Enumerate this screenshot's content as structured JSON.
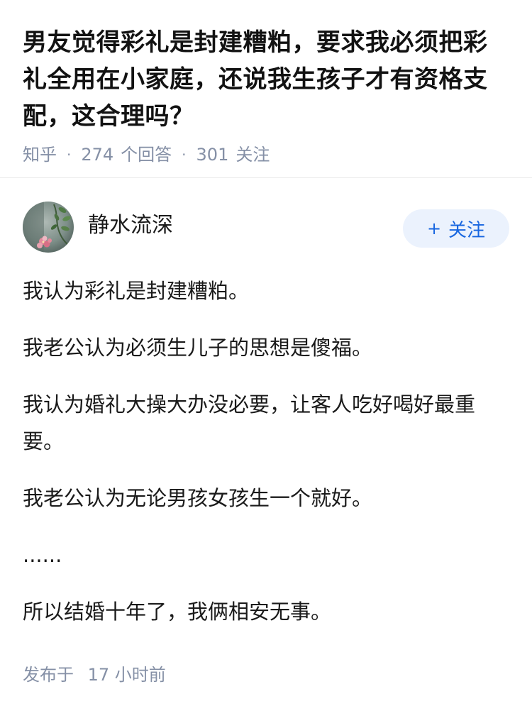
{
  "question": {
    "title": "男友觉得彩礼是封建糟粕，要求我必须把彩礼全用在小家庭，还说我生孩子才有资格支配，这合理吗？",
    "source": "知乎",
    "answer_count": "274",
    "answer_label": "个回答",
    "follower_count": "301",
    "follower_label": "关注",
    "separator": "·"
  },
  "author": {
    "name": "静水流深",
    "avatar_icon": "avatar-photo",
    "follow_label": "关注",
    "follow_icon": "plus-icon",
    "follow_color": "#1766e0",
    "follow_bg": "#ebf2fd"
  },
  "answer": {
    "paragraphs": [
      "我认为彩礼是封建糟粕。",
      "我老公认为必须生儿子的思想是傻福。",
      "我认为婚礼大操大办没必要，让客人吃好喝好最重要。",
      "我老公认为无论男孩女孩生一个就好。",
      "......",
      "所以结婚十年了，我俩相安无事。"
    ],
    "published_label": "发布于",
    "published_time": "17 小时前"
  },
  "colors": {
    "meta_text": "#8590a6",
    "body_text": "#1a1a1a",
    "divider": "#ebebeb"
  }
}
